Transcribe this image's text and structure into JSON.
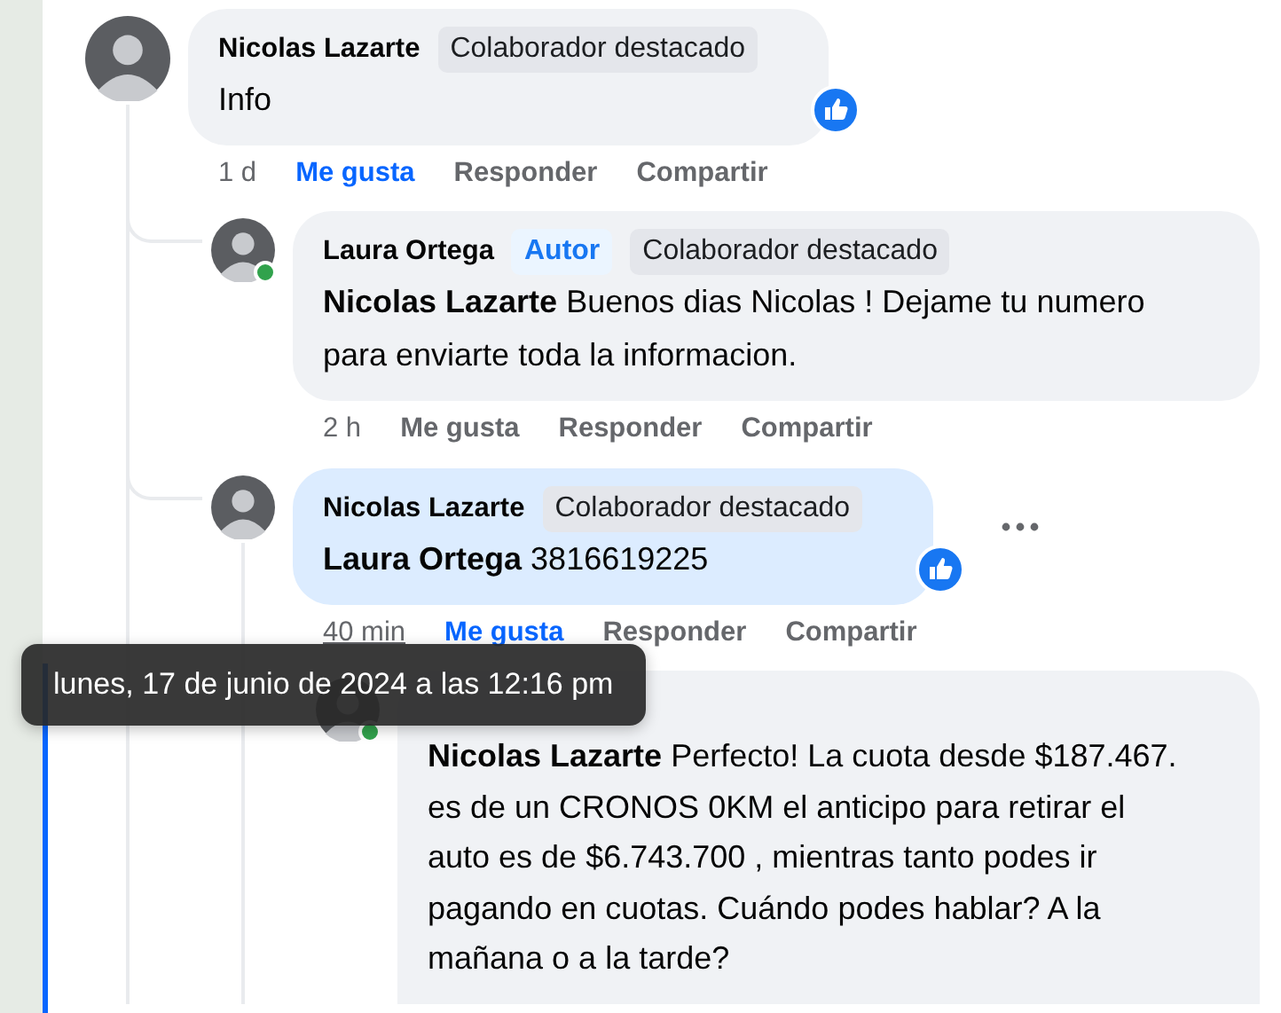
{
  "comments": [
    {
      "author": "Nicolas Lazarte",
      "badges": [
        {
          "label": "Colaborador destacado",
          "kind": "featured"
        }
      ],
      "text": "Info",
      "liked": true,
      "time": "1 d",
      "actions": [
        {
          "label": "Me gusta",
          "selected": true
        },
        {
          "label": "Responder",
          "selected": false
        },
        {
          "label": "Compartir",
          "selected": false
        }
      ],
      "children": [
        {
          "author": "Laura Ortega",
          "online": true,
          "badges": [
            {
              "label": "Autor",
              "kind": "author"
            },
            {
              "label": "Colaborador destacado",
              "kind": "featured"
            }
          ],
          "text": "**Nicolas Lazarte** Buenos dias Nicolas ! Dejame tu numero para enviarte toda la informacion.",
          "time": "2 h",
          "actions": [
            {
              "label": "Me gusta",
              "selected": false
            },
            {
              "label": "Responder",
              "selected": false
            },
            {
              "label": "Compartir",
              "selected": false
            }
          ]
        },
        {
          "author": "Nicolas Lazarte",
          "highlighted": true,
          "badges": [
            {
              "label": "Colaborador destacado",
              "kind": "featured"
            }
          ],
          "text": "**Laura Ortega** 3816619225",
          "liked": true,
          "more_button": true,
          "time": "40 min",
          "time_hovered": true,
          "actions": [
            {
              "label": "Me gusta",
              "selected": true
            },
            {
              "label": "Responder",
              "selected": false
            },
            {
              "label": "Compartir",
              "selected": false
            }
          ],
          "children": [
            {
              "online": true,
              "focused": true,
              "text": "**Nicolas Lazarte** Perfecto! La cuota desde $187.467. es de un CRONOS 0KM el anticipo para retirar el auto es de $6.743.700 , mientras tanto podes ir pagando en cuotas. Cuándo podes hablar? A la mañana o a la tarde?"
            }
          ]
        }
      ]
    }
  ],
  "tooltip": {
    "text": "lunes, 17 de junio de 2024 a las 12:16 pm"
  }
}
